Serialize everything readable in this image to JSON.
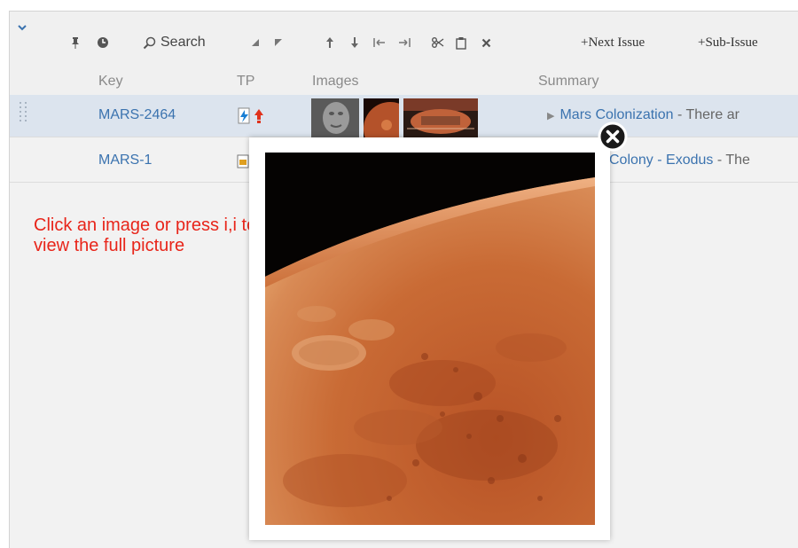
{
  "toolbar": {
    "search_label": "Search",
    "next_issue_label": "+Next Issue",
    "sub_issue_label": "+Sub-Issue"
  },
  "columns": {
    "key": "Key",
    "tp": "TP",
    "images": "Images",
    "summary": "Summary"
  },
  "rows": [
    {
      "key": "MARS-2464",
      "summary_link": "Mars Colonization",
      "summary_rest": " - There ar"
    },
    {
      "key": "MARS-1",
      "summary_link": "Colony - Exodus",
      "summary_rest": " - The"
    }
  ],
  "hint": "Click an image or press i,i to view the full picture",
  "colors": {
    "link": "#3b73af",
    "selected_row": "#dce4ee",
    "hint": "#e8251a",
    "mars": "#c0622a"
  }
}
